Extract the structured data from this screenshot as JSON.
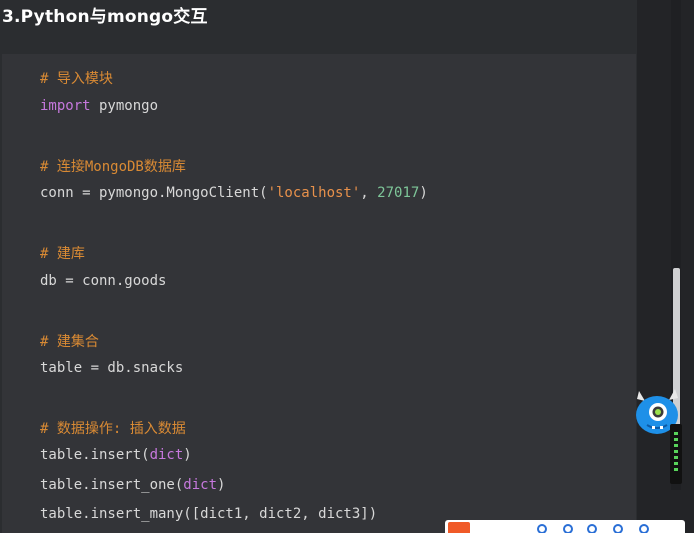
{
  "heading": "3.Python与mongo交互",
  "code": {
    "lines": [
      {
        "comment": "# 导入模块"
      },
      {
        "kw": "import",
        "rest": " pymongo"
      },
      {
        "comment": "# 连接MongoDB数据库"
      },
      {
        "pre": "conn = pymongo.MongoClient(",
        "str": "'localhost'",
        "mid": ", ",
        "num": "27017",
        "post": ")"
      },
      {
        "comment": "# 建库"
      },
      {
        "text": "db = conn.goods"
      },
      {
        "comment": "# 建集合"
      },
      {
        "text": "table = db.snacks"
      },
      {
        "comment": "# 数据操作: 插入数据"
      },
      {
        "pre": "table.insert(",
        "builtin": "dict",
        "post": ")"
      },
      {
        "pre": "table.insert_one(",
        "builtin": "dict",
        "post": ")"
      },
      {
        "text": "table.insert_many([dict1, dict2, dict3])"
      }
    ]
  },
  "colors": {
    "background": "#2b2d30",
    "code_background": "#333438",
    "comment": "#d98a34",
    "keyword": "#c678dd",
    "string": "#e8914b",
    "number": "#7ec699"
  },
  "icons": {
    "mascot": "blue-monster-mascot-icon",
    "toolbar_logo": "csdn-logo-icon"
  }
}
